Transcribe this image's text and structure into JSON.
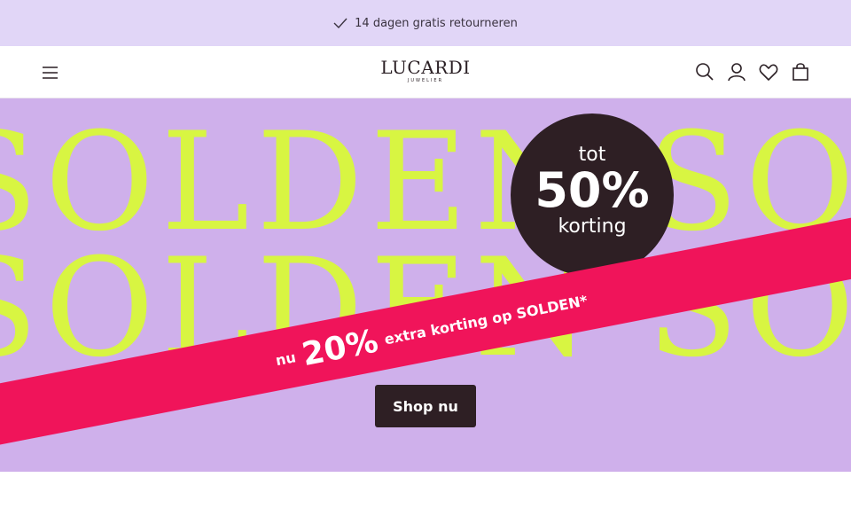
{
  "announcement": {
    "text": "14 dagen gratis retourneren",
    "icon": "check-icon"
  },
  "header": {
    "logo_main": "LUCARDI",
    "logo_sub": "JUWELIER",
    "icons": [
      "menu-icon",
      "search-icon",
      "account-icon",
      "wishlist-icon",
      "cart-icon"
    ]
  },
  "hero": {
    "background_word": "SOLDEN",
    "badge": {
      "line1": "tot",
      "line2": "50%",
      "line3": "korting"
    },
    "ribbon": {
      "prefix": "nu",
      "percent": "20%",
      "suffix": "extra korting op SOLDEN*"
    },
    "cta_label": "Shop nu",
    "colors": {
      "background": "#cfb0eb",
      "text": "#d8f542",
      "ribbon": "#f0145a",
      "badge": "#2e1f24"
    }
  }
}
